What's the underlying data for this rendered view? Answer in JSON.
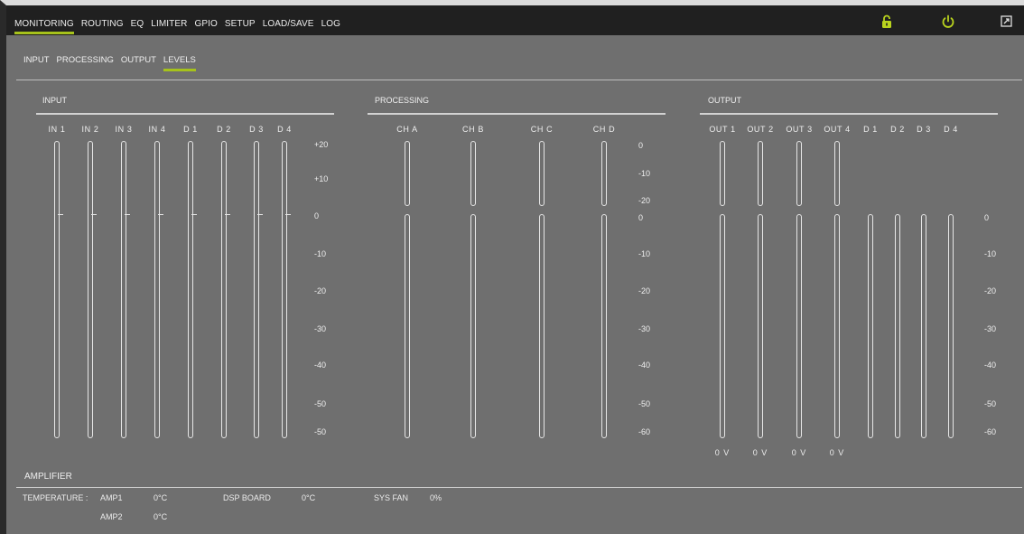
{
  "top_menu": {
    "items": [
      "MONITORING",
      "ROUTING",
      "EQ",
      "LIMITER",
      "GPIO",
      "SETUP",
      "LOAD/SAVE",
      "LOG"
    ],
    "active": "MONITORING",
    "icons": {
      "lock": "unlocked-padlock-icon",
      "power": "power-icon",
      "fullscreen": "fullscreen-icon"
    },
    "accent_color": "#a6c21b"
  },
  "sub_menu": {
    "items": [
      "INPUT",
      "PROCESSING",
      "OUTPUT",
      "LEVELS"
    ],
    "active": "LEVELS"
  },
  "levels": {
    "input": {
      "title": "INPUT",
      "channels": [
        "IN 1",
        "IN 2",
        "IN 3",
        "IN 4",
        "D 1",
        "D 2",
        "D 3",
        "D 4"
      ],
      "scale": [
        "+20",
        "+10",
        "0",
        "-10",
        "-20",
        "-30",
        "-40",
        "-50",
        "-50"
      ]
    },
    "processing": {
      "title": "PROCESSING",
      "channels": [
        "CH A",
        "CH B",
        "CH C",
        "CH D"
      ],
      "gr_scale": [
        "0",
        "-10",
        "-20"
      ],
      "scale": [
        "0",
        "-10",
        "-20",
        "-30",
        "-40",
        "-50",
        "-60"
      ]
    },
    "output": {
      "title": "OUTPUT",
      "channels": [
        "OUT 1",
        "OUT 2",
        "OUT 3",
        "OUT 4",
        "D 1",
        "D 2",
        "D 3",
        "D 4"
      ],
      "scale": [
        "0",
        "-10",
        "-20",
        "-30",
        "-40",
        "-50",
        "-60"
      ],
      "voltages": [
        "0 V",
        "0 V",
        "0 V",
        "0 V"
      ]
    }
  },
  "amplifier": {
    "title": "AMPLIFIER",
    "temperature_label": "TEMPERATURE :",
    "amp1_label": "AMP1",
    "amp1_value": "0°C",
    "amp2_label": "AMP2",
    "amp2_value": "0°C",
    "dsp_label": "DSP BOARD",
    "dsp_value": "0°C",
    "fan_label": "SYS FAN",
    "fan_value": "0%"
  }
}
